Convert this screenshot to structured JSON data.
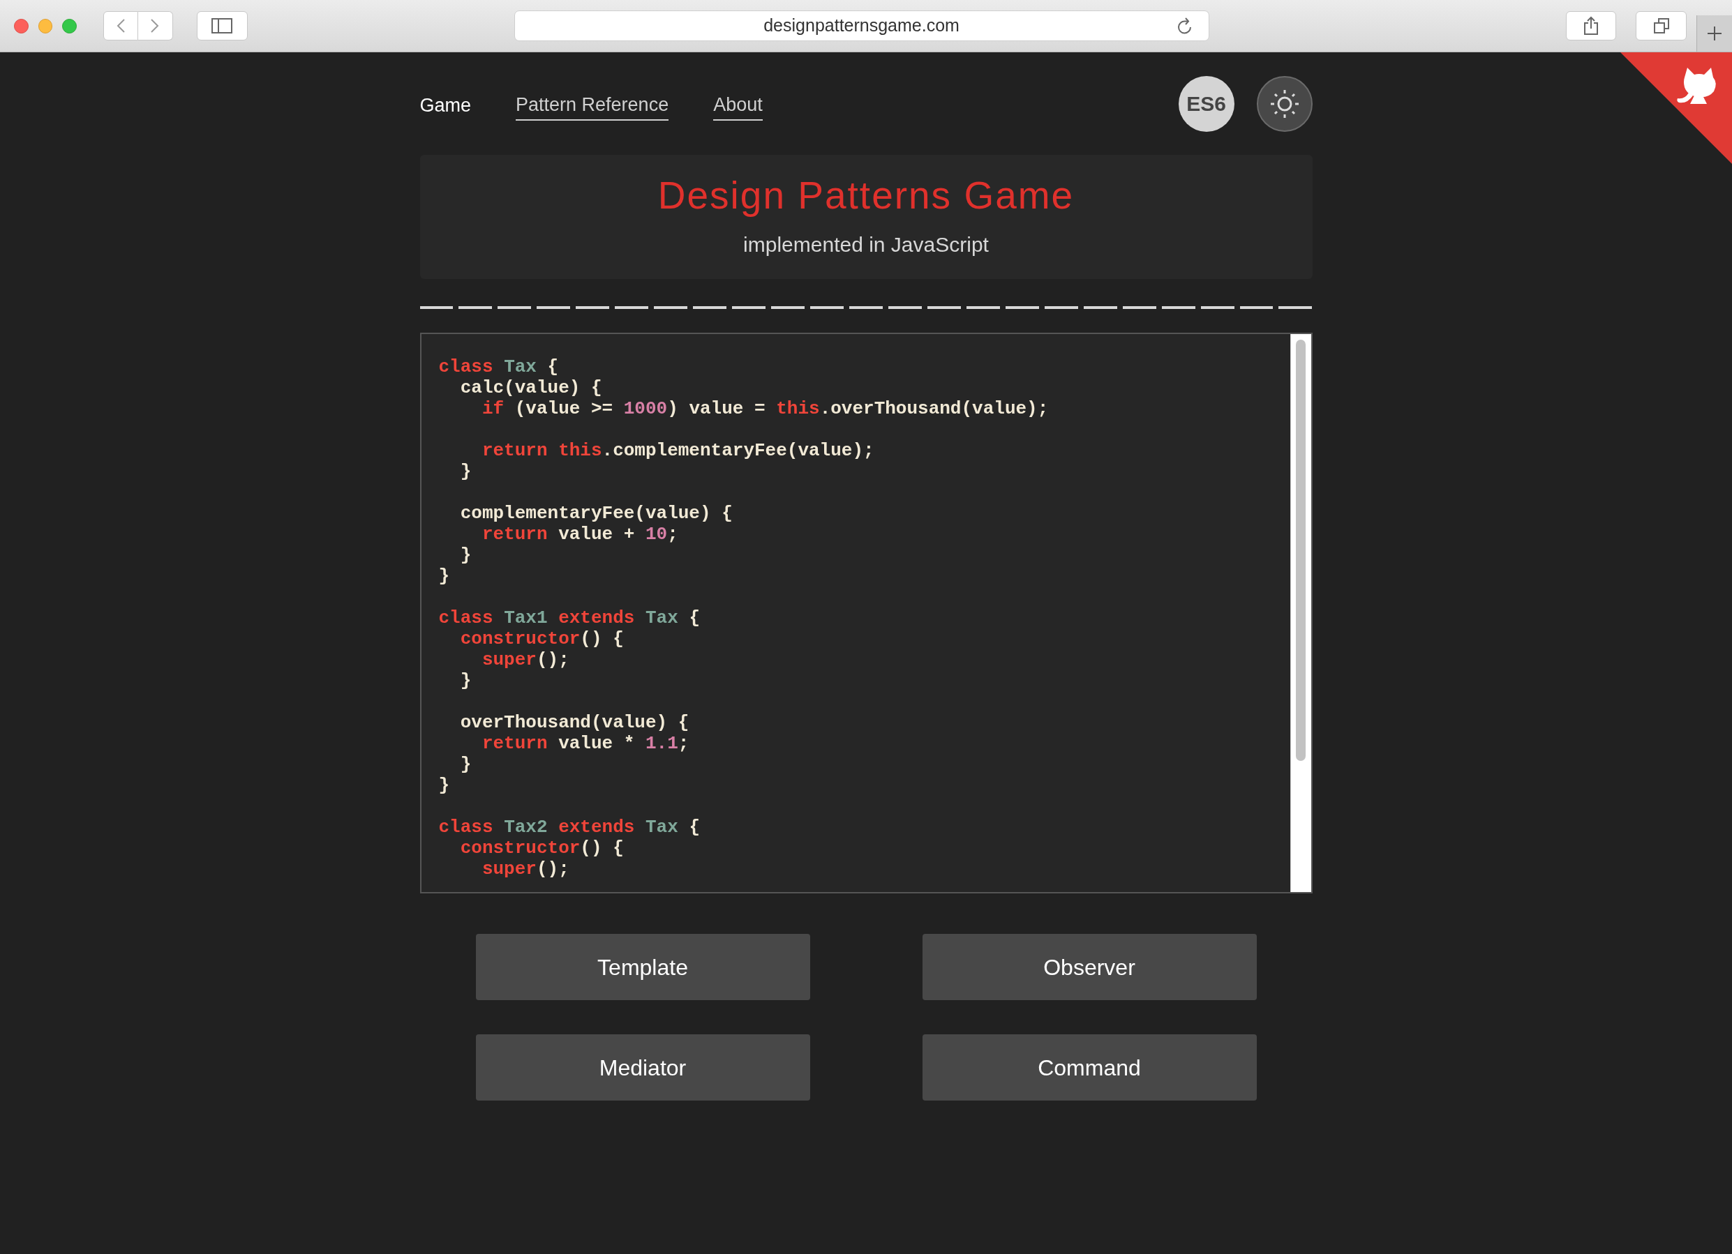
{
  "browser": {
    "url": "designpatternsgame.com"
  },
  "nav": [
    {
      "label": "Game",
      "selected": true
    },
    {
      "label": "Pattern Reference",
      "selected": false
    },
    {
      "label": "About",
      "selected": false
    }
  ],
  "es6_toggle": {
    "label": "ES6"
  },
  "header": {
    "title": "Design Patterns Game",
    "subtitle": "implemented in JavaScript"
  },
  "progress": [
    {
      "answered": false
    },
    {
      "answered": false
    },
    {
      "answered": false
    },
    {
      "answered": false
    },
    {
      "answered": false
    },
    {
      "answered": false
    },
    {
      "answered": false
    },
    {
      "answered": false
    },
    {
      "answered": false
    },
    {
      "answered": false
    },
    {
      "answered": false
    },
    {
      "answered": false
    },
    {
      "answered": false
    },
    {
      "answered": false
    },
    {
      "answered": false
    },
    {
      "answered": false
    },
    {
      "answered": false
    },
    {
      "answered": false
    },
    {
      "answered": false
    },
    {
      "answered": false
    },
    {
      "answered": false
    },
    {
      "answered": false
    },
    {
      "answered": false
    }
  ],
  "code": [
    {
      "kind": "code",
      "tokens": [
        {
          "kind": "keyword",
          "text": "class "
        },
        {
          "kind": "type",
          "text": "Tax"
        },
        {
          "kind": "plain",
          "text": " {"
        }
      ]
    },
    {
      "kind": "code",
      "tokens": [
        {
          "kind": "plain",
          "text": "  calc(value) {"
        }
      ]
    },
    {
      "kind": "code",
      "tokens": [
        {
          "kind": "keyword",
          "text": "    if"
        },
        {
          "kind": "plain",
          "text": " (value >= "
        },
        {
          "kind": "number",
          "text": "1000"
        },
        {
          "kind": "plain",
          "text": ") value = "
        },
        {
          "kind": "keyword",
          "text": "this"
        },
        {
          "kind": "plain",
          "text": ".overThousand(value);"
        }
      ]
    },
    {
      "kind": "blank"
    },
    {
      "kind": "code",
      "tokens": [
        {
          "kind": "keyword",
          "text": "    return this"
        },
        {
          "kind": "plain",
          "text": ".complementaryFee(value);"
        }
      ]
    },
    {
      "kind": "code",
      "tokens": [
        {
          "kind": "plain",
          "text": "  }"
        }
      ]
    },
    {
      "kind": "blank"
    },
    {
      "kind": "code",
      "tokens": [
        {
          "kind": "plain",
          "text": "  complementaryFee(value) {"
        }
      ]
    },
    {
      "kind": "code",
      "tokens": [
        {
          "kind": "keyword",
          "text": "    return"
        },
        {
          "kind": "plain",
          "text": " value + "
        },
        {
          "kind": "number",
          "text": "10"
        },
        {
          "kind": "plain",
          "text": ";"
        }
      ]
    },
    {
      "kind": "code",
      "tokens": [
        {
          "kind": "plain",
          "text": "  }"
        }
      ]
    },
    {
      "kind": "code",
      "tokens": [
        {
          "kind": "plain",
          "text": "}"
        }
      ]
    },
    {
      "kind": "blank"
    },
    {
      "kind": "code",
      "tokens": [
        {
          "kind": "keyword",
          "text": "class "
        },
        {
          "kind": "type",
          "text": "Tax1"
        },
        {
          "kind": "keyword",
          "text": " extends "
        },
        {
          "kind": "type",
          "text": "Tax"
        },
        {
          "kind": "plain",
          "text": " {"
        }
      ]
    },
    {
      "kind": "code",
      "tokens": [
        {
          "kind": "keyword",
          "text": "  constructor"
        },
        {
          "kind": "plain",
          "text": "() {"
        }
      ]
    },
    {
      "kind": "code",
      "tokens": [
        {
          "kind": "keyword",
          "text": "    super"
        },
        {
          "kind": "plain",
          "text": "();"
        }
      ]
    },
    {
      "kind": "code",
      "tokens": [
        {
          "kind": "plain",
          "text": "  }"
        }
      ]
    },
    {
      "kind": "blank"
    },
    {
      "kind": "code",
      "tokens": [
        {
          "kind": "plain",
          "text": "  overThousand(value) {"
        }
      ]
    },
    {
      "kind": "code",
      "tokens": [
        {
          "kind": "keyword",
          "text": "    return"
        },
        {
          "kind": "plain",
          "text": " value * "
        },
        {
          "kind": "number",
          "text": "1.1"
        },
        {
          "kind": "plain",
          "text": ";"
        }
      ]
    },
    {
      "kind": "code",
      "tokens": [
        {
          "kind": "plain",
          "text": "  }"
        }
      ]
    },
    {
      "kind": "code",
      "tokens": [
        {
          "kind": "plain",
          "text": "}"
        }
      ]
    },
    {
      "kind": "blank"
    },
    {
      "kind": "code",
      "tokens": [
        {
          "kind": "keyword",
          "text": "class "
        },
        {
          "kind": "type",
          "text": "Tax2"
        },
        {
          "kind": "keyword",
          "text": " extends "
        },
        {
          "kind": "type",
          "text": "Tax"
        },
        {
          "kind": "plain",
          "text": " {"
        }
      ]
    },
    {
      "kind": "code",
      "tokens": [
        {
          "kind": "keyword",
          "text": "  constructor"
        },
        {
          "kind": "plain",
          "text": "() {"
        }
      ]
    },
    {
      "kind": "code",
      "tokens": [
        {
          "kind": "keyword",
          "text": "    super"
        },
        {
          "kind": "plain",
          "text": "();"
        }
      ]
    }
  ],
  "answers": [
    "Template",
    "Observer",
    "Mediator",
    "Command"
  ]
}
